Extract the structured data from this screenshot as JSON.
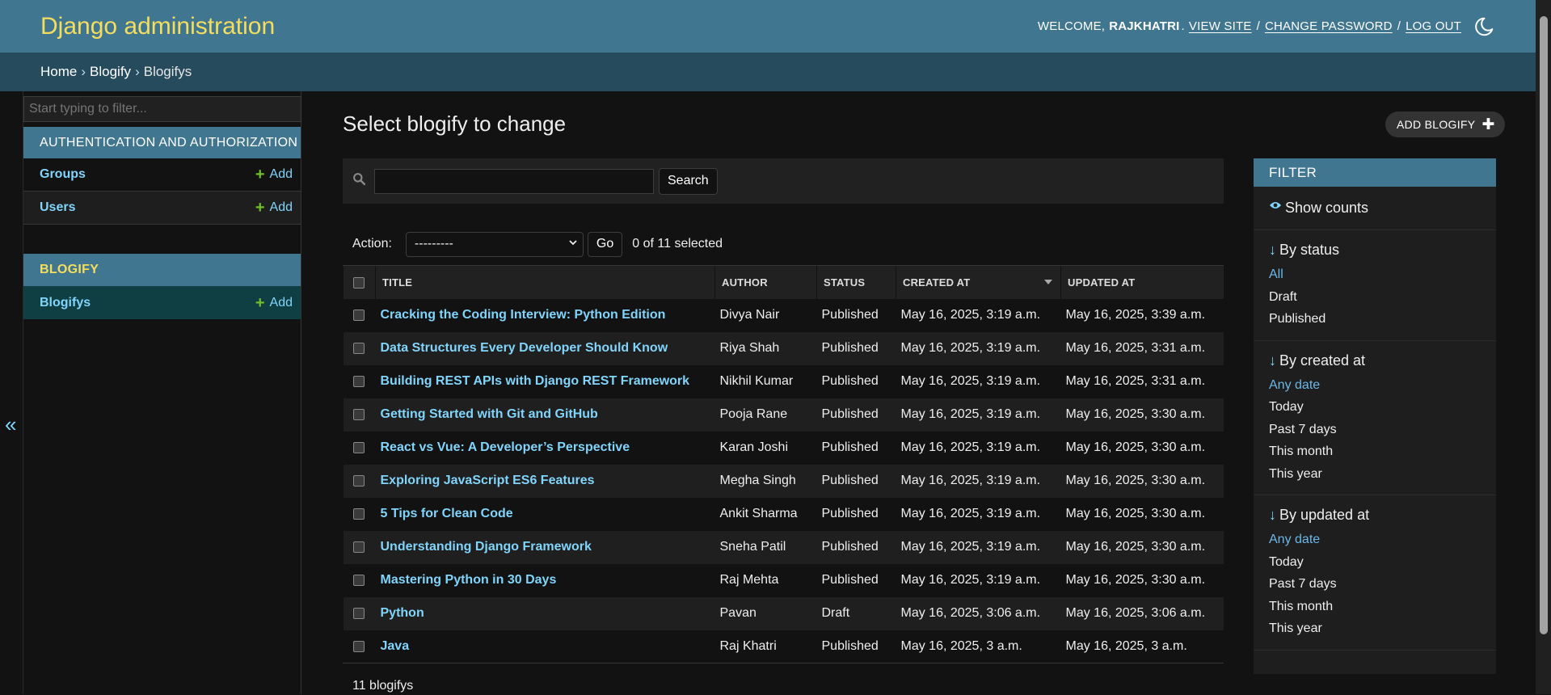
{
  "header": {
    "branding": "Django administration",
    "welcome": "Welcome,",
    "username": "rajkhatri",
    "username_suffix": ".",
    "view_site": "View site",
    "change_password": "Change password",
    "log_out": "Log out",
    "separator": "/",
    "theme_icon": "moon-icon"
  },
  "breadcrumbs": {
    "items": [
      "Home",
      "Blogify",
      "Blogifys"
    ],
    "separator": "›"
  },
  "sidebar": {
    "filter_placeholder": "Start typing to filter...",
    "apps": [
      {
        "name": "Authentication and Authorization",
        "models": [
          {
            "name": "Groups",
            "add": "Add"
          },
          {
            "name": "Users",
            "add": "Add"
          }
        ]
      },
      {
        "name": "Blogify",
        "models": [
          {
            "name": "Blogifys",
            "add": "Add"
          }
        ]
      }
    ],
    "toggle": "«"
  },
  "content": {
    "title": "Select blogify to change",
    "add_button": "Add blogify",
    "add_plus": "✚",
    "search_button": "Search",
    "search_value": "",
    "action_label": "Action:",
    "action_selected": "---------",
    "go_button": "Go",
    "selected_count": "0 of 11 selected",
    "columns": [
      "Title",
      "Author",
      "Status",
      "Created at",
      "Updated at"
    ],
    "rows": [
      {
        "title": "Cracking the Coding Interview: Python Edition",
        "author": "Divya Nair",
        "status": "Published",
        "created": "May 16, 2025, 3:19 a.m.",
        "updated": "May 16, 2025, 3:39 a.m."
      },
      {
        "title": "Data Structures Every Developer Should Know",
        "author": "Riya Shah",
        "status": "Published",
        "created": "May 16, 2025, 3:19 a.m.",
        "updated": "May 16, 2025, 3:31 a.m."
      },
      {
        "title": "Building REST APIs with Django REST Framework",
        "author": "Nikhil Kumar",
        "status": "Published",
        "created": "May 16, 2025, 3:19 a.m.",
        "updated": "May 16, 2025, 3:31 a.m."
      },
      {
        "title": "Getting Started with Git and GitHub",
        "author": "Pooja Rane",
        "status": "Published",
        "created": "May 16, 2025, 3:19 a.m.",
        "updated": "May 16, 2025, 3:30 a.m."
      },
      {
        "title": "React vs Vue: A Developer’s Perspective",
        "author": "Karan Joshi",
        "status": "Published",
        "created": "May 16, 2025, 3:19 a.m.",
        "updated": "May 16, 2025, 3:30 a.m."
      },
      {
        "title": "Exploring JavaScript ES6 Features",
        "author": "Megha Singh",
        "status": "Published",
        "created": "May 16, 2025, 3:19 a.m.",
        "updated": "May 16, 2025, 3:30 a.m."
      },
      {
        "title": "5 Tips for Clean Code",
        "author": "Ankit Sharma",
        "status": "Published",
        "created": "May 16, 2025, 3:19 a.m.",
        "updated": "May 16, 2025, 3:30 a.m."
      },
      {
        "title": "Understanding Django Framework",
        "author": "Sneha Patil",
        "status": "Published",
        "created": "May 16, 2025, 3:19 a.m.",
        "updated": "May 16, 2025, 3:30 a.m."
      },
      {
        "title": "Mastering Python in 30 Days",
        "author": "Raj Mehta",
        "status": "Published",
        "created": "May 16, 2025, 3:19 a.m.",
        "updated": "May 16, 2025, 3:30 a.m."
      },
      {
        "title": "Python",
        "author": "Pavan",
        "status": "Draft",
        "created": "May 16, 2025, 3:06 a.m.",
        "updated": "May 16, 2025, 3:06 a.m."
      },
      {
        "title": "Java",
        "author": "Raj Khatri",
        "status": "Published",
        "created": "May 16, 2025, 3 a.m.",
        "updated": "May 16, 2025, 3 a.m."
      }
    ],
    "paginator": "11 blogifys"
  },
  "filter": {
    "title": "Filter",
    "show_counts": "Show counts",
    "groups": [
      {
        "title": "By status",
        "options": [
          "All",
          "Draft",
          "Published"
        ],
        "selected": 0
      },
      {
        "title": "By created at",
        "options": [
          "Any date",
          "Today",
          "Past 7 days",
          "This month",
          "This year"
        ],
        "selected": 0
      },
      {
        "title": "By updated at",
        "options": [
          "Any date",
          "Today",
          "Past 7 days",
          "This month",
          "This year"
        ],
        "selected": 0
      }
    ]
  },
  "colors": {
    "header_bg": "#417690",
    "breadcrumbs_bg": "#264b5d",
    "branding": "#f5dd5d",
    "link": "#81d4fa",
    "add_plus": "#70bf2b",
    "body_bg": "#121212"
  }
}
